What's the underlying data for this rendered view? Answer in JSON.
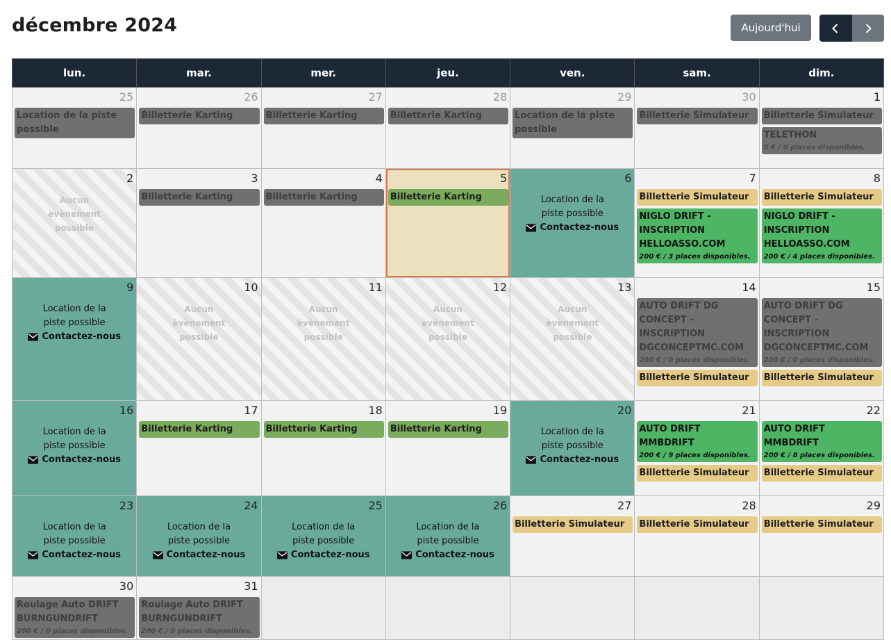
{
  "header": {
    "title": "décembre 2024",
    "today_label": "Aujourd'hui"
  },
  "weekdays": [
    "lun.",
    "mar.",
    "mer.",
    "jeu.",
    "ven.",
    "sam.",
    "dim."
  ],
  "labels": {
    "no_event": "Aucun èvènement possible",
    "location": "Location de la piste possible",
    "contact": "Contactez-nous"
  },
  "weeks": [
    [
      {
        "day": "25",
        "other": true,
        "events": [
          {
            "t": "Location de la piste possible",
            "c": "gray"
          }
        ]
      },
      {
        "day": "26",
        "other": true,
        "events": [
          {
            "t": "Billetterie Karting",
            "c": "gray"
          }
        ]
      },
      {
        "day": "27",
        "other": true,
        "events": [
          {
            "t": "Billetterie Karting",
            "c": "gray"
          }
        ]
      },
      {
        "day": "28",
        "other": true,
        "events": [
          {
            "t": "Billetterie Karting",
            "c": "gray"
          }
        ]
      },
      {
        "day": "29",
        "other": true,
        "events": [
          {
            "t": "Location de la piste possible",
            "c": "gray"
          }
        ]
      },
      {
        "day": "30",
        "other": true,
        "events": [
          {
            "t": "Billetterie Simulateur",
            "c": "gray"
          }
        ]
      },
      {
        "day": "1",
        "events": [
          {
            "t": "Billetterie Simulateur",
            "c": "gray"
          },
          {
            "t": "TELETHON",
            "c": "gray",
            "sub": "0 € / 0 places disponibles."
          }
        ]
      }
    ],
    [
      {
        "day": "2",
        "kind": "none"
      },
      {
        "day": "3",
        "events": [
          {
            "t": "Billetterie Karting",
            "c": "gray"
          }
        ]
      },
      {
        "day": "4",
        "events": [
          {
            "t": "Billetterie Karting",
            "c": "gray"
          }
        ]
      },
      {
        "day": "5",
        "today": true,
        "events": [
          {
            "t": "Billetterie Karting",
            "c": "lgreen"
          }
        ]
      },
      {
        "day": "6",
        "kind": "location"
      },
      {
        "day": "7",
        "events": [
          {
            "t": "Billetterie Simulateur",
            "c": "yellow"
          },
          {
            "t": "NIGLO DRIFT - INSCRIPTION HELLOASSO.COM",
            "c": "green",
            "sub": "200 € / 3 places disponibles."
          }
        ]
      },
      {
        "day": "8",
        "events": [
          {
            "t": "Billetterie Simulateur",
            "c": "yellow"
          },
          {
            "t": "NIGLO DRIFT - INSCRIPTION HELLOASSO.COM",
            "c": "green",
            "sub": "200 € / 4 places disponibles."
          }
        ]
      }
    ],
    [
      {
        "day": "9",
        "kind": "location"
      },
      {
        "day": "10",
        "kind": "none"
      },
      {
        "day": "11",
        "kind": "none"
      },
      {
        "day": "12",
        "kind": "none"
      },
      {
        "day": "13",
        "kind": "none"
      },
      {
        "day": "14",
        "events": [
          {
            "t": "AUTO DRIFT DG CONCEPT - INSCRIPTION DGCONCEPTMC.COM",
            "c": "gray",
            "sub": "200 € / 0 places disponibles."
          },
          {
            "t": "Billetterie Simulateur",
            "c": "yellow"
          }
        ]
      },
      {
        "day": "15",
        "events": [
          {
            "t": "AUTO DRIFT DG CONCEPT - INSCRIPTION DGCONCEPTMC.COM",
            "c": "gray",
            "sub": "200 € / 0 places disponibles."
          },
          {
            "t": "Billetterie Simulateur",
            "c": "yellow"
          }
        ]
      }
    ],
    [
      {
        "day": "16",
        "kind": "location"
      },
      {
        "day": "17",
        "events": [
          {
            "t": "Billetterie Karting",
            "c": "lgreen"
          }
        ]
      },
      {
        "day": "18",
        "events": [
          {
            "t": "Billetterie Karting",
            "c": "lgreen"
          }
        ]
      },
      {
        "day": "19",
        "events": [
          {
            "t": "Billetterie Karting",
            "c": "lgreen"
          }
        ]
      },
      {
        "day": "20",
        "kind": "location"
      },
      {
        "day": "21",
        "events": [
          {
            "t": "AUTO DRIFT MMBDRIFT",
            "c": "green",
            "sub": "200 € / 9 places disponibles."
          },
          {
            "t": "Billetterie Simulateur",
            "c": "yellow"
          }
        ]
      },
      {
        "day": "22",
        "events": [
          {
            "t": "AUTO DRIFT MMBDRIFT",
            "c": "green",
            "sub": "200 € / 8 places disponibles."
          },
          {
            "t": "Billetterie Simulateur",
            "c": "yellow"
          }
        ]
      }
    ],
    [
      {
        "day": "23",
        "kind": "location"
      },
      {
        "day": "24",
        "kind": "location"
      },
      {
        "day": "25",
        "kind": "location"
      },
      {
        "day": "26",
        "kind": "location"
      },
      {
        "day": "27",
        "events": [
          {
            "t": "Billetterie Simulateur",
            "c": "yellow"
          }
        ]
      },
      {
        "day": "28",
        "events": [
          {
            "t": "Billetterie Simulateur",
            "c": "yellow"
          }
        ]
      },
      {
        "day": "29",
        "events": [
          {
            "t": "Billetterie Simulateur",
            "c": "yellow"
          }
        ]
      }
    ],
    [
      {
        "day": "30",
        "events": [
          {
            "t": "Roulage Auto DRIFT BURNGUNDRIFT",
            "c": "gray",
            "sub": "200 € / 0 places disponibles."
          }
        ]
      },
      {
        "day": "31",
        "events": [
          {
            "t": "Roulage Auto DRIFT BURNGUNDRIFT",
            "c": "gray",
            "sub": "200 € / 0 places disponibles."
          }
        ]
      },
      {
        "kind": "filler"
      },
      {
        "kind": "filler"
      },
      {
        "kind": "filler"
      },
      {
        "kind": "filler"
      },
      {
        "kind": "filler"
      }
    ]
  ],
  "icons": {
    "prev": "chevron-left-icon",
    "next": "chevron-right-icon",
    "contact": "envelope-icon"
  },
  "colors": {
    "header_bg": "#1c2836",
    "teal": "#6aaa9b",
    "today_bg": "#ece0bf",
    "today_border": "#e07848",
    "event_gray": "#707070",
    "event_green": "#4db564",
    "event_light_green": "#7bab5c",
    "event_yellow": "#e6ca88"
  }
}
